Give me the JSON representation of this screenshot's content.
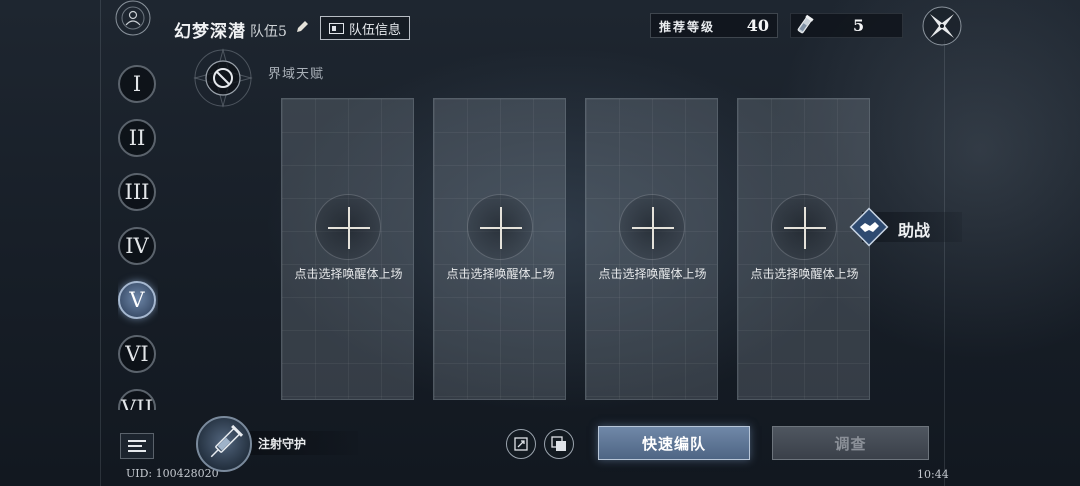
{
  "header": {
    "team_name": "幻梦深潜",
    "team_number": "队伍5",
    "team_info_label": "队伍信息",
    "recommended_level_label": "推荐等级",
    "recommended_level_value": "40",
    "resource_count": "5"
  },
  "side_nav": {
    "items": [
      {
        "label": "I",
        "active": false
      },
      {
        "label": "II",
        "active": false
      },
      {
        "label": "III",
        "active": false
      },
      {
        "label": "IV",
        "active": false
      },
      {
        "label": "V",
        "active": true
      },
      {
        "label": "VI",
        "active": false
      },
      {
        "label": "VII",
        "active": false
      }
    ]
  },
  "talent": {
    "label": "界域天赋"
  },
  "slots": [
    {
      "text": "点击选择唤醒体上场"
    },
    {
      "text": "点击选择唤醒体上场"
    },
    {
      "text": "点击选择唤醒体上场"
    },
    {
      "text": "点击选择唤醒体上场"
    }
  ],
  "support": {
    "label": "助战"
  },
  "footer": {
    "uid": "UID: 100428020",
    "skill_label": "注射守护",
    "quick_formation_label": "快速编队",
    "investigate_label": "调查",
    "time": "10:44"
  },
  "colors": {
    "accent": "#6d86a8",
    "background": "#171e27"
  }
}
